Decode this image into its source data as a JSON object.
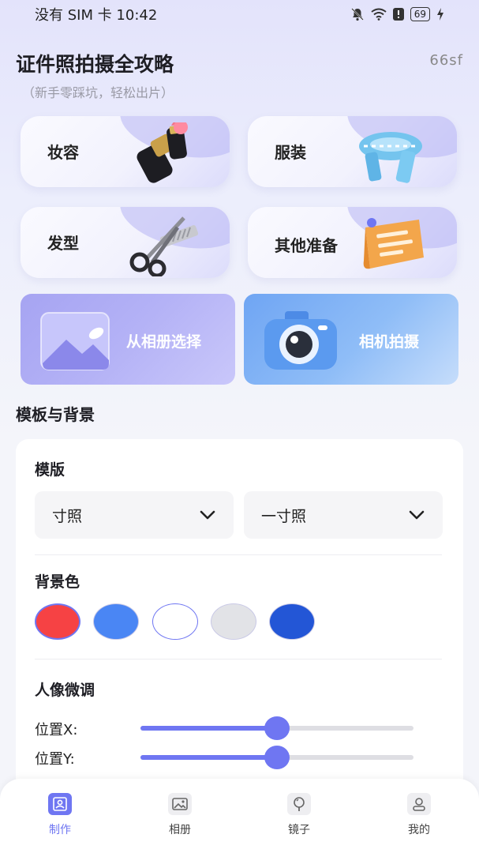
{
  "status_bar": {
    "left_text": "没有 SIM 卡 10:42",
    "battery": "69",
    "icons": [
      "mute-bell-icon",
      "wifi-icon",
      "alert-icon",
      "battery-icon",
      "charging-icon"
    ]
  },
  "header": {
    "title": "证件照拍摄全攻略",
    "brand": "66sf",
    "subtitle": "（新手零踩坑，轻松出片）"
  },
  "guides": [
    {
      "label": "妆容",
      "icon": "lipstick-icon"
    },
    {
      "label": "服装",
      "icon": "scarf-icon"
    },
    {
      "label": "发型",
      "icon": "scissors-comb-icon"
    },
    {
      "label": "其他准备",
      "icon": "checklist-paper-icon"
    }
  ],
  "actions": [
    {
      "label": "从相册选择",
      "icon": "photo-album-icon"
    },
    {
      "label": "相机拍摄",
      "icon": "camera-icon"
    }
  ],
  "section_title": "模板与背景",
  "template": {
    "heading": "模版",
    "select_type": "寸照",
    "select_size": "一寸照"
  },
  "background": {
    "heading": "背景色",
    "colors": [
      "#f64244",
      "#4a86f4",
      "#ffffff",
      "#e2e3e7",
      "#2356d6"
    ],
    "selected_index": 0
  },
  "portrait": {
    "heading": "人像微调",
    "sliders": [
      {
        "label": "位置X:",
        "value": 0.5
      },
      {
        "label": "位置Y:",
        "value": 0.5
      }
    ]
  },
  "tabbar": {
    "tabs": [
      {
        "label": "制作",
        "icon": "portrait-frame-icon",
        "active": true
      },
      {
        "label": "相册",
        "icon": "image-icon",
        "active": false
      },
      {
        "label": "镜子",
        "icon": "mirror-icon",
        "active": false
      },
      {
        "label": "我的",
        "icon": "user-icon",
        "active": false
      }
    ]
  },
  "colors": {
    "accent": "#6f76f2",
    "album_card": "#9a98ef",
    "camera_card": "#6ea8f4"
  }
}
